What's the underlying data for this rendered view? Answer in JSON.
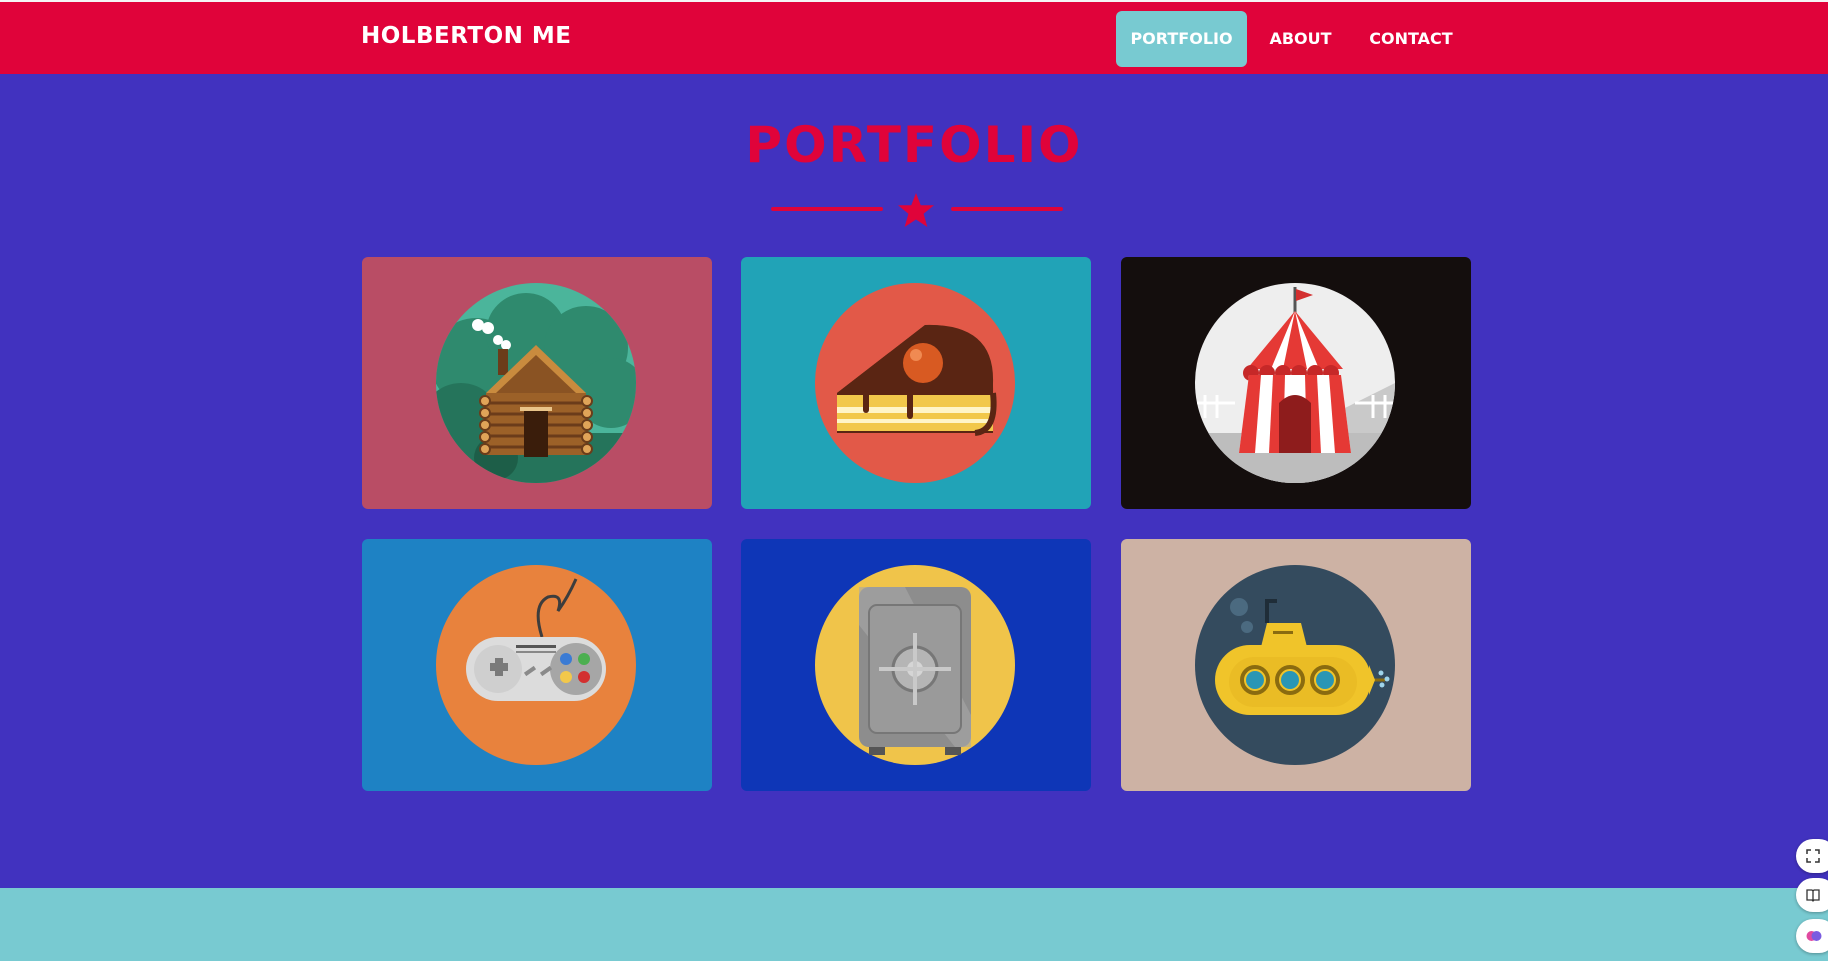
{
  "brand": "HOLBERTON ME",
  "nav": {
    "portfolio": "PORTFOLIO",
    "about": "ABOUT",
    "contact": "CONTACT"
  },
  "portfolio": {
    "title": "PORTFOLIO",
    "items": [
      {
        "icon": "log-cabin-icon",
        "bg": "#b94d65"
      },
      {
        "icon": "cake-slice-icon",
        "bg": "#21a3b7"
      },
      {
        "icon": "circus-tent-icon",
        "bg": "#140e0d"
      },
      {
        "icon": "game-controller-icon",
        "bg": "#1e82c4"
      },
      {
        "icon": "safe-icon",
        "bg": "#0e36b7"
      },
      {
        "icon": "submarine-icon",
        "bg": "#cdb2a4"
      }
    ]
  },
  "colors": {
    "navbar": "#e0033a",
    "page_bg": "#4132bf",
    "active_tab": "#78cad1",
    "footer": "#78cad1",
    "accent": "#e0033a"
  },
  "side_tools": [
    {
      "icon": "expand-icon"
    },
    {
      "icon": "book-icon"
    },
    {
      "icon": "brain-icon"
    }
  ]
}
